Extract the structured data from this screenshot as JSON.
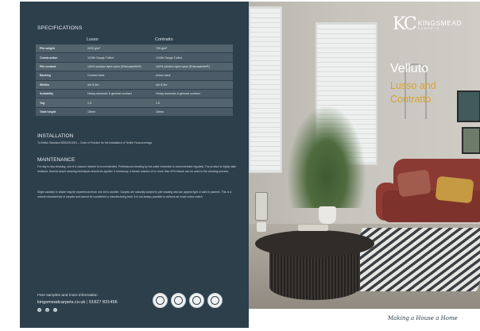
{
  "specifications": {
    "title": "SPECIFICATIONS",
    "columns": [
      "Lusso",
      "Contratto"
    ],
    "rows": [
      {
        "label": "Pile weight",
        "lusso": "2200 g/m²",
        "contratto": "720 g/m²"
      },
      {
        "label": "Construction",
        "lusso": "1/10th Gauge Tufted",
        "contratto": "1/10th Gauge Tufted"
      },
      {
        "label": "Pile content",
        "lusso": "100% solution dyed nylon (Enkmastrelle®)",
        "contratto": "100% solution dyed nylon (Enkmastrelle®)"
      },
      {
        "label": "Backing",
        "lusso": "Comfort back",
        "contratto": "Action back"
      },
      {
        "label": "Widths",
        "lusso": "4m & 5m",
        "contratto": "4m & 5m"
      },
      {
        "label": "Suitability",
        "lusso": "Heavy domestic & general contract",
        "contratto": "Heavy domestic & general contract"
      },
      {
        "label": "Tog",
        "lusso": "1.5",
        "contratto": "1.5"
      },
      {
        "label": "Total height",
        "lusso": "15mm",
        "contratto": "15mm"
      }
    ]
  },
  "installation": {
    "title": "INSTALLATION",
    "text": "To British Standard BS5325:2001 – Code of Practice for the Installation of Textile Floorcoverings"
  },
  "maintenance": {
    "title": "MAINTENANCE",
    "p1": "For day to day cleaning, use of a vacuum cleaner is recommended. Professional cleaning by hot water extraction is recommended regularly. The product is highly stain resistant. Normal carpet cleaning techniques should be applied. If necessary, a bleach solution of no more than 20% bleach can be used in the cleaning process.",
    "p2": "Slight variation in shade may be experienced from one lot to another. Carpets are naturally subject to pile shading and can appear light or dark in patches. This is a natural characteristic of carpets and cannot be considered a manufacturing fault. It is not always possible to achieve an exact colour match."
  },
  "contact": {
    "line1": "Free samples and more information",
    "website": "kingsmeadcarpets.co.uk",
    "separator": "|",
    "phone": "01827 831456",
    "socials": [
      "f",
      "◎",
      "✓"
    ]
  },
  "badges": [
    "certification-badge-1",
    "certification-badge-2",
    "certification-badge-3",
    "certification-badge-4"
  ],
  "brand": {
    "mark": "KC",
    "name": "KINGSMEAD",
    "sub": "CARPETS"
  },
  "product": {
    "title": "Velluto",
    "subtitle_line1": "Lusso and",
    "subtitle_line2": "Contratto"
  },
  "tagline": "Making a House a Home",
  "colors": {
    "panel": "#2e3f4c",
    "accent": "#d7a236",
    "text_light": "#e6ecef"
  }
}
